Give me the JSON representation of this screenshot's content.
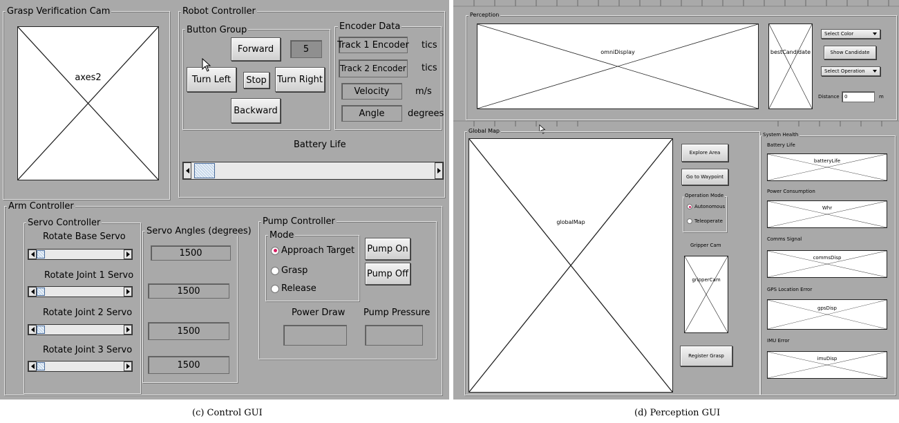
{
  "left": {
    "grasp_cam": {
      "title": "Grasp Verification Cam",
      "axes_label": "axes2"
    },
    "robot_controller": {
      "title": "Robot Controller",
      "button_group": {
        "title": "Button Group",
        "forward": "Forward",
        "speed_value": "5",
        "turn_left": "Turn Left",
        "stop": "Stop",
        "turn_right": "Turn Right",
        "backward": "Backward"
      },
      "encoder": {
        "title": "Encoder Data",
        "track1": "Track 1 Encoder",
        "track1_unit": "tics",
        "track2": "Track 2 Encoder",
        "track2_unit": "tics",
        "velocity": "Velocity",
        "velocity_unit": "m/s",
        "angle": "Angle",
        "angle_unit": "degrees"
      },
      "battery": {
        "label": "Battery Life",
        "level": 0.0
      }
    },
    "arm_controller": {
      "title": "Arm Controller",
      "servo_controller": {
        "title": "Servo Controller",
        "servos": [
          {
            "label": "Rotate Base Servo"
          },
          {
            "label": "Rotate Joint 1 Servo"
          },
          {
            "label": "Rotate Joint 2 Servo"
          },
          {
            "label": "Rotate Joint 3 Servo"
          }
        ]
      },
      "servo_angles": {
        "title": "Servo Angles (degrees)",
        "values": [
          "1500",
          "1500",
          "1500",
          "1500"
        ]
      },
      "pump_controller": {
        "title": "Pump Controller",
        "mode": {
          "title": "Mode",
          "options": [
            "Approach Target",
            "Grasp",
            "Release"
          ],
          "selected": "Approach Target"
        },
        "pump_on": "Pump On",
        "pump_off": "Pump Off",
        "power_draw": "Power Draw",
        "pump_pressure": "Pump Pressure"
      }
    },
    "caption": "(c) Control GUI"
  },
  "right": {
    "perception": {
      "title": "Perception",
      "omni_label": "omniDisplay",
      "best_label": "bestCandidate",
      "select_color": "Select Color",
      "show_candidate": "Show Candidate",
      "select_operation": "Select Operation",
      "distance_label": "Distance :",
      "distance_value": "0",
      "distance_unit": "m"
    },
    "global_map": {
      "title": "Global Map",
      "map_label": "globalMap",
      "explore": "Explore Area",
      "waypoint": "Go to Waypoint",
      "op_mode": {
        "title": "Operation Mode",
        "options": [
          "Autonomous",
          "Teleoperate"
        ],
        "selected": "Autonomous"
      },
      "gripper_title": "Gripper Cam",
      "gripper_label": "gripperCam",
      "register": "Register Grasp"
    },
    "system_health": {
      "title": "System Health",
      "items": [
        {
          "title": "Battery Life",
          "label": "batteryLife"
        },
        {
          "title": "Power Consumption",
          "label": "Whr"
        },
        {
          "title": "Comms Signal",
          "label": "commsDisp"
        },
        {
          "title": "GPS Location Error",
          "label": "gpsDisp"
        },
        {
          "title": "IMU Error",
          "label": "imuDisp"
        }
      ]
    },
    "caption": "(d) Perception GUI"
  }
}
